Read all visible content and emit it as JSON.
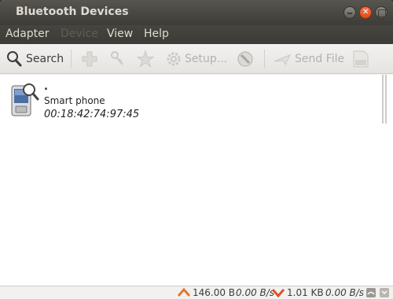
{
  "window": {
    "title": "Bluetooth Devices"
  },
  "menu": [
    {
      "label": "Adapter",
      "enabled": true
    },
    {
      "label": "Device",
      "enabled": false
    },
    {
      "label": "View",
      "enabled": true
    },
    {
      "label": "Help",
      "enabled": true
    }
  ],
  "toolbar": {
    "search_label": "Search",
    "setup_label": "Setup...",
    "send_file_label": "Send File"
  },
  "devices": [
    {
      "name": ".",
      "type": "Smart phone",
      "address": "00:18:42:74:97:45"
    }
  ],
  "status": {
    "sent_total": "146.00 B",
    "sent_rate": "0.00 B/s",
    "received_total": "1.01 KB",
    "received_rate": "0.00 B/s"
  },
  "colors": {
    "accent": "#dd4814",
    "upload": "#e07a2e",
    "download": "#d9532c"
  }
}
